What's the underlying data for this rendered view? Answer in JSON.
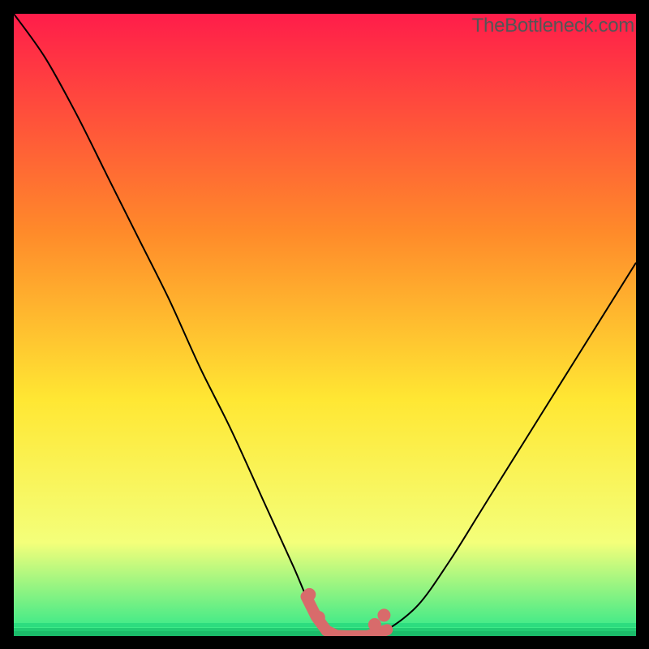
{
  "watermark": "TheBottleneck.com",
  "palette": {
    "background": "#000000",
    "gradient_top": "#ff1d4a",
    "gradient_mid1": "#ff8a2a",
    "gradient_mid2": "#ffe733",
    "gradient_mid3": "#f4ff7a",
    "gradient_bottom": "#2ce88a",
    "curve": "#000000",
    "optimal_marker": "#d86b6b"
  },
  "chart_data": {
    "type": "line",
    "title": "",
    "xlabel": "",
    "ylabel": "",
    "xlim": [
      0,
      100
    ],
    "ylim": [
      0,
      100
    ],
    "series": [
      {
        "name": "bottleneck-curve",
        "x": [
          0,
          5,
          10,
          15,
          20,
          25,
          30,
          35,
          40,
          45,
          48,
          50,
          52,
          55,
          57,
          60,
          65,
          70,
          75,
          80,
          85,
          90,
          95,
          100
        ],
        "y": [
          100,
          93,
          84,
          74,
          64,
          54,
          43,
          33,
          22,
          11,
          4,
          1,
          0,
          0,
          0,
          1,
          5,
          12,
          20,
          28,
          36,
          44,
          52,
          60
        ]
      }
    ],
    "annotations": [
      {
        "name": "optimal-range",
        "x_start": 47,
        "x_end": 60,
        "y": 0
      }
    ],
    "grid": false,
    "legend": false
  }
}
